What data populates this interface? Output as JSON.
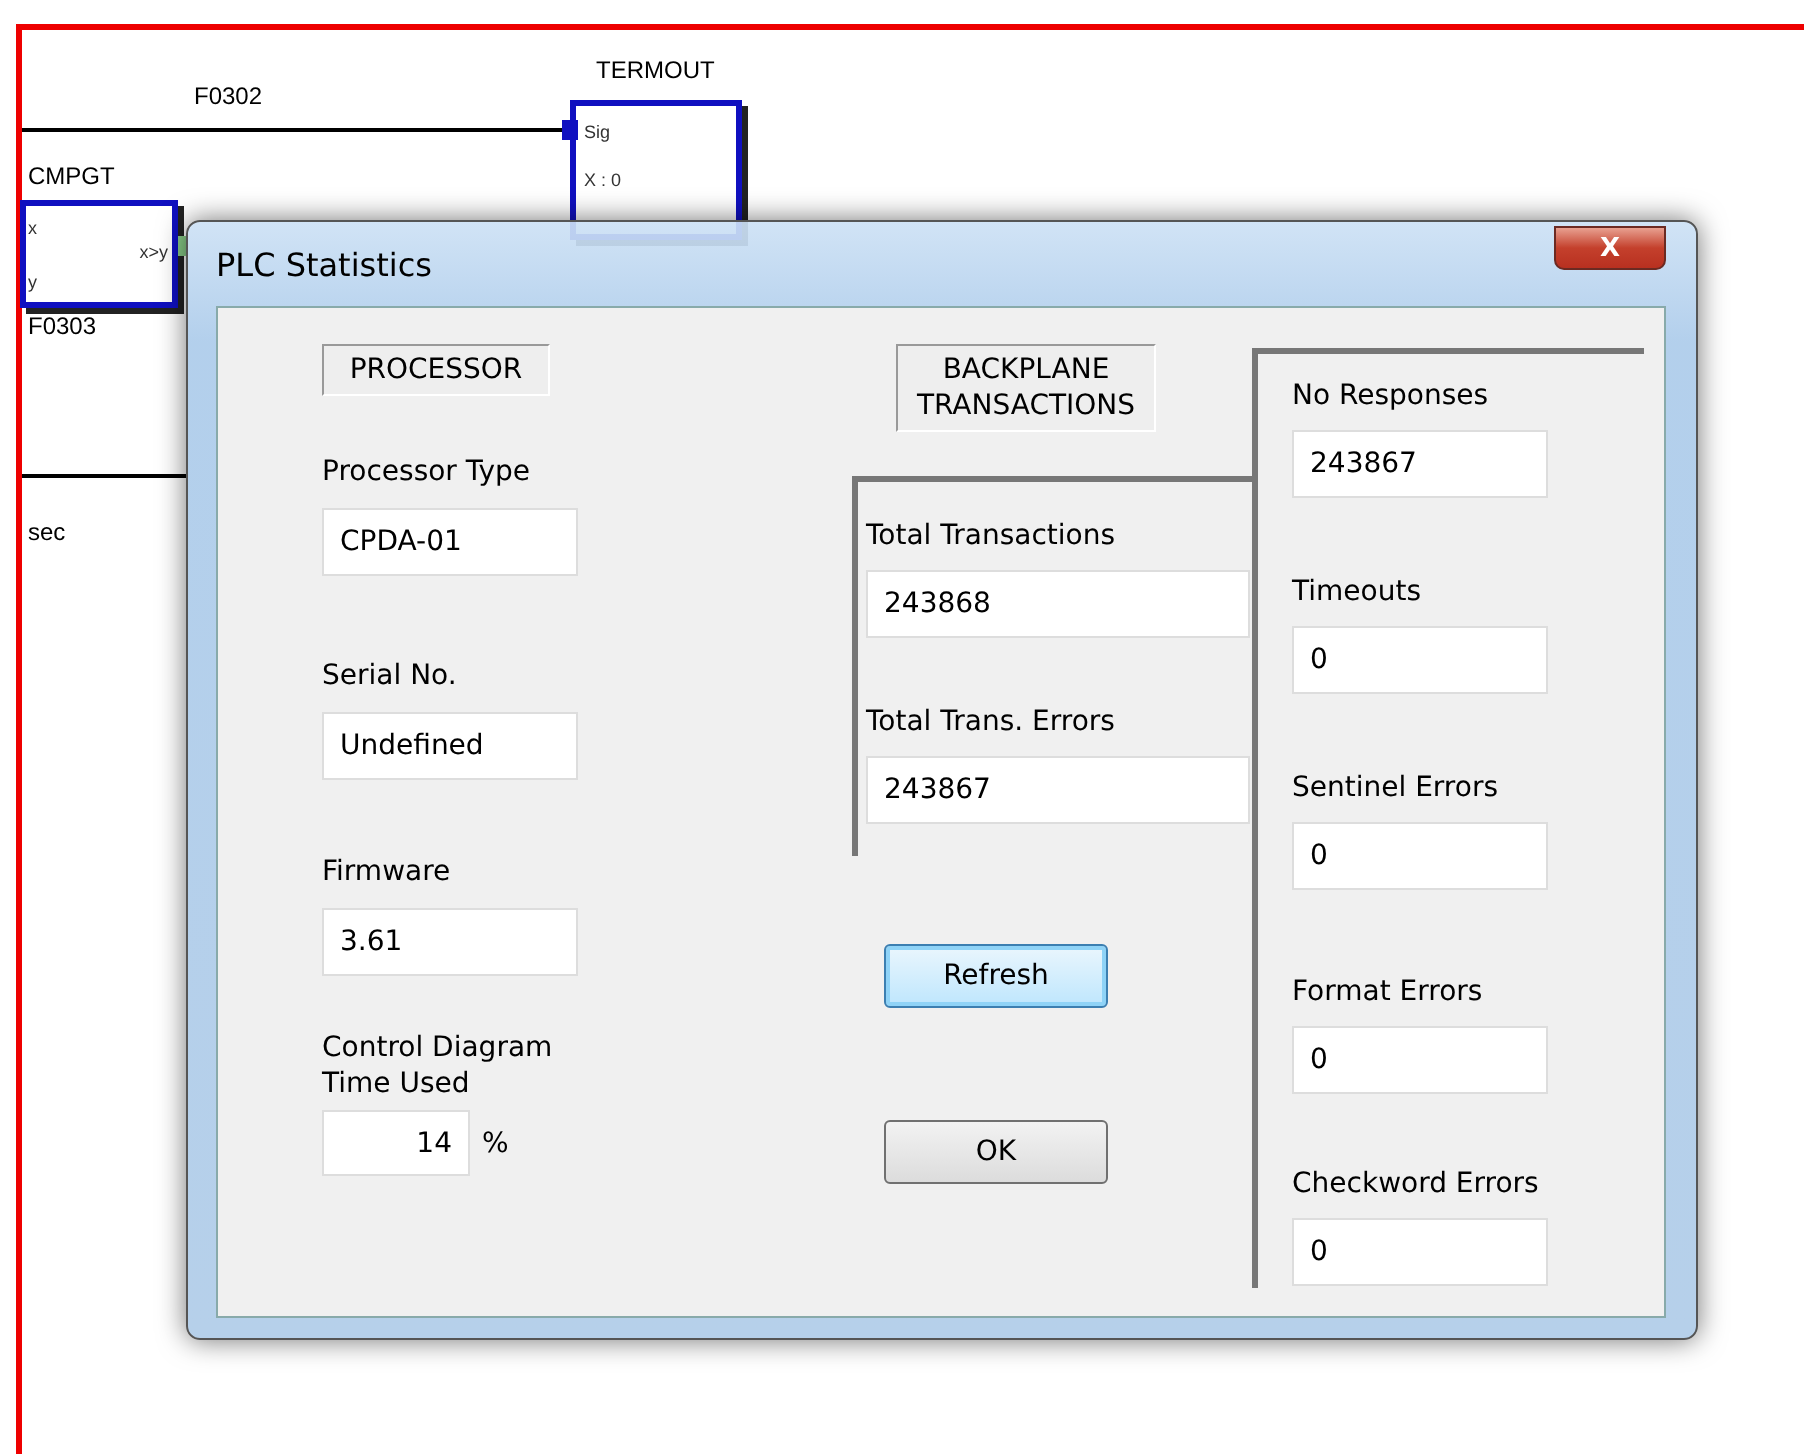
{
  "diagram": {
    "wires": [
      {
        "label": "F0302"
      }
    ],
    "blocks": [
      {
        "title": "TERMOUT",
        "ports": [
          "Sig",
          "X : 0"
        ]
      },
      {
        "title": "CMPGT",
        "ports": [
          "x",
          "x>y",
          "y"
        ],
        "output": "F0303"
      }
    ],
    "notes": [
      "sec"
    ]
  },
  "dialog": {
    "title": "PLC Statistics",
    "close": "X",
    "processor": {
      "heading": "PROCESSOR",
      "fields": [
        {
          "label": "Processor Type",
          "value": "CPDA-01"
        },
        {
          "label": "Serial No.",
          "value": "Undefined"
        },
        {
          "label": "Firmware",
          "value": "3.61"
        }
      ],
      "time_label": "Control Diagram Time Used",
      "time_value": "14",
      "time_unit": "%"
    },
    "backplane": {
      "heading": "BACKPLANE TRANSACTIONS",
      "fields": [
        {
          "label": "Total Transactions",
          "value": "243868"
        },
        {
          "label": "Total Trans. Errors",
          "value": "243867"
        }
      ]
    },
    "errors": [
      {
        "label": "No Responses",
        "value": "243867"
      },
      {
        "label": "Timeouts",
        "value": "0"
      },
      {
        "label": "Sentinel Errors",
        "value": "0"
      },
      {
        "label": "Format Errors",
        "value": "0"
      },
      {
        "label": "Checkword Errors",
        "value": "0"
      }
    ],
    "buttons": [
      {
        "label": "Refresh",
        "focused": true
      },
      {
        "label": "OK",
        "focused": false
      }
    ]
  }
}
